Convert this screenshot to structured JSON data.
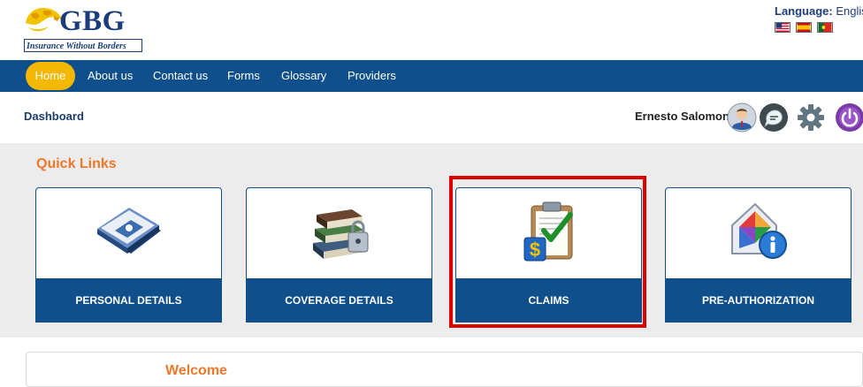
{
  "logo": {
    "name": "GBG",
    "tagline": "Insurance Without Borders"
  },
  "language": {
    "label": "Language:",
    "value": "English",
    "flags": [
      "us-flag",
      "spain-flag",
      "portugal-flag"
    ]
  },
  "nav": {
    "items": [
      "Home",
      "About us",
      "Contact us",
      "Forms",
      "Glossary",
      "Providers"
    ],
    "active": "Home"
  },
  "dashboard": {
    "title": "Dashboard",
    "user": "Ernesto Salomon",
    "icons": [
      "user-avatar-icon",
      "chat-icon",
      "settings-gear-icon",
      "power-icon"
    ]
  },
  "quick_links": {
    "title": "Quick Links",
    "cards": [
      {
        "label": "PERSONAL DETAILS",
        "icon": "contact-book-icon"
      },
      {
        "label": "COVERAGE DETAILS",
        "icon": "books-lock-icon"
      },
      {
        "label": "CLAIMS",
        "icon": "clipboard-money-icon",
        "highlighted": true
      },
      {
        "label": "PRE-AUTHORIZATION",
        "icon": "house-info-icon"
      }
    ]
  },
  "welcome": {
    "title": "Welcome"
  },
  "colors": {
    "nav_bg": "#0f4f8c",
    "home_pill": "#f5b800",
    "accent_orange": "#f0782a",
    "highlight": "#e10000",
    "panel_bg": "#ececec"
  }
}
